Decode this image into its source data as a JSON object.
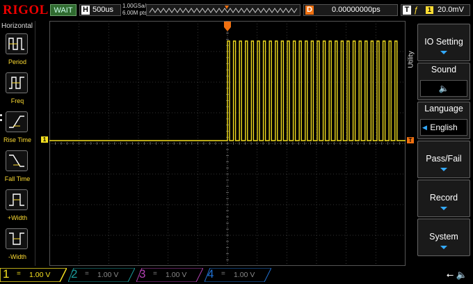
{
  "top": {
    "logo": "RIGOL",
    "run_status": "WAIT",
    "timebase_letter": "H",
    "timebase": "500us",
    "sample_rate": "1.00GSa/s",
    "memory_depth": "6.00M pts",
    "delay_letter": "D",
    "delay": "0.00000000ps",
    "trigger_letter": "T",
    "trigger_edge": "ƒ",
    "trigger_channel": "1",
    "trigger_level": "20.0mV"
  },
  "left_menu": {
    "title": "Horizontal",
    "items": [
      {
        "label": "Period"
      },
      {
        "label": "Freq"
      },
      {
        "label": "Rise Time"
      },
      {
        "label": "Fall Time"
      },
      {
        "label": "+Width"
      },
      {
        "label": "-Width"
      }
    ]
  },
  "right_menu": {
    "title": "Utility",
    "items": [
      {
        "label": "IO Setting"
      },
      {
        "label": "Sound",
        "value": "🔈"
      },
      {
        "label": "Language",
        "value": "English"
      },
      {
        "label": "Pass/Fail"
      },
      {
        "label": "Record"
      },
      {
        "label": "System"
      }
    ]
  },
  "channels": [
    {
      "num": "1",
      "eq": "=",
      "value": "1.00 V",
      "color": "#f5e020"
    },
    {
      "num": "2",
      "eq": "=",
      "value": "1.00 V",
      "color": "#1a9a9a"
    },
    {
      "num": "3",
      "eq": "=",
      "value": "1.00 V",
      "color": "#b040b0"
    },
    {
      "num": "4",
      "eq": "=",
      "value": "1.00 V",
      "color": "#2070d0"
    }
  ],
  "markers": {
    "ch1_marker": "1",
    "trigger_level_marker": "T"
  },
  "colors": {
    "ch1": "#f5e020",
    "trigger": "#f07010",
    "accent": "#33aaff"
  }
}
